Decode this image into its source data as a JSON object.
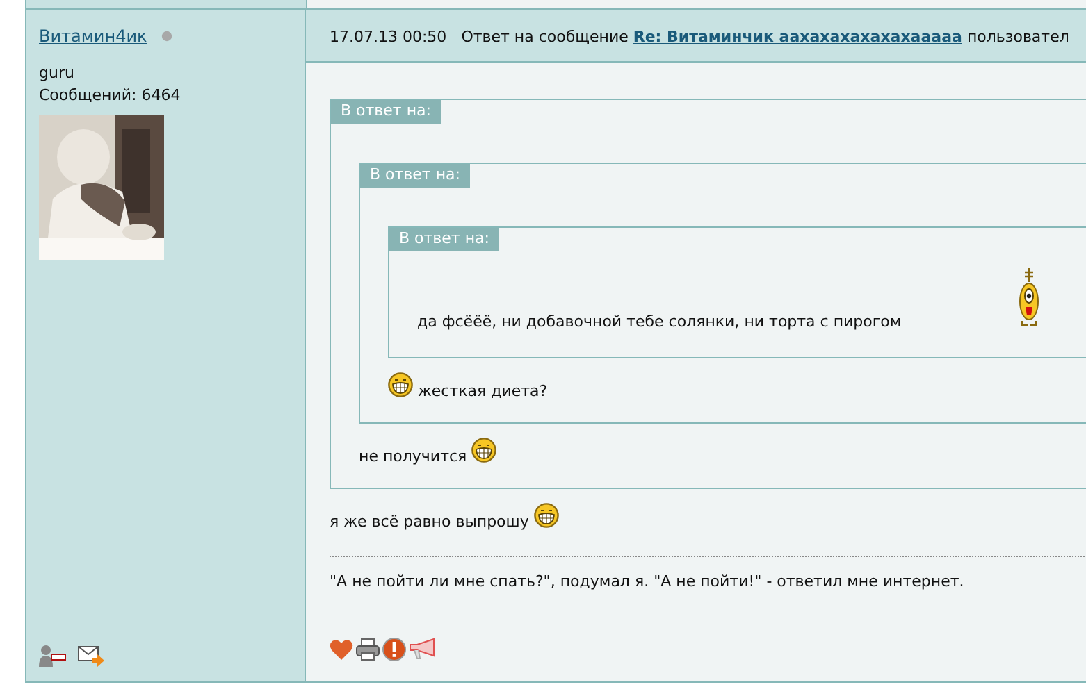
{
  "user": {
    "name": "Витамин4ик",
    "online": false,
    "rank": "guru",
    "posts": "Сообщений: 6464"
  },
  "post": {
    "date": "17.07.13 00:50",
    "reply_prefix": "Ответ на сообщение",
    "reply_link": "Re: Витаминчик аахахахахахахааааа",
    "reply_suffix": "пользовател"
  },
  "quote": {
    "label": "В ответ на:",
    "quote": {
      "label": "В ответ на:",
      "quote": {
        "label": "В ответ на:",
        "lines": [
          {
            "parts": [
              {
                "kind": "text",
                "text": "да фсёёё, ни добавочной тебе солянки, ни торта с пирогом"
              },
              {
                "kind": "creature"
              }
            ]
          }
        ]
      },
      "lines": [
        {
          "parts": [
            {
              "kind": "grin"
            },
            {
              "kind": "text",
              "text": "жесткая диета?"
            }
          ]
        }
      ]
    },
    "lines": [
      {
        "parts": [
          {
            "kind": "text",
            "text": "не получится"
          },
          {
            "kind": "grin"
          }
        ]
      }
    ]
  },
  "lines": [
    {
      "parts": [
        {
          "kind": "text",
          "text": "я же всё равно выпрошу"
        },
        {
          "kind": "grin"
        }
      ]
    }
  ],
  "signature": "\"А не пойти ли мне спать?\", подумал я. \"А не пойти!\" - ответил мне интернет."
}
